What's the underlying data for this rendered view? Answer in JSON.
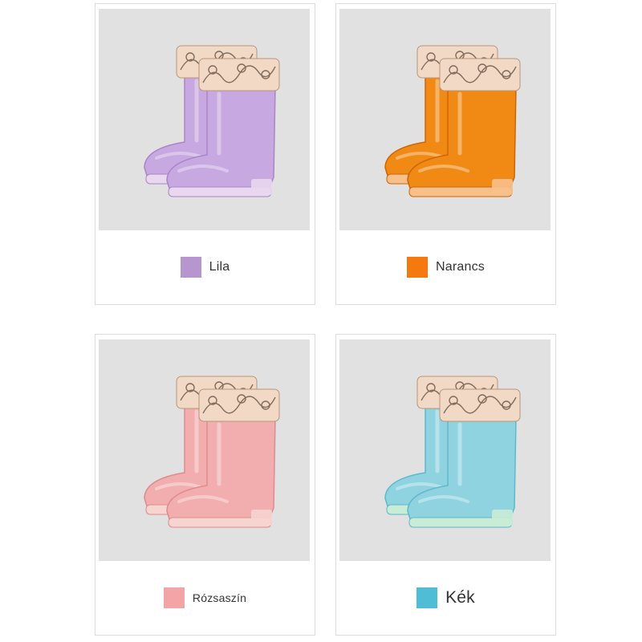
{
  "products": [
    {
      "name": "Lila",
      "swatch": "#b795cf",
      "boot": "#c8a8e0",
      "boot_shade": "#a985c6",
      "sole": "#e8d7ee"
    },
    {
      "name": "Narancs",
      "swatch": "#f47a0f",
      "boot": "#f08a14",
      "boot_shade": "#cc6508",
      "sole": "#f7c08b"
    },
    {
      "name": "Rózsaszín",
      "swatch": "#f4a3a6",
      "boot": "#f2aeae",
      "boot_shade": "#dd8b8e",
      "sole": "#f6d4cf"
    },
    {
      "name": "Kék",
      "swatch": "#4fbdd6",
      "boot": "#8fd3e1",
      "boot_shade": "#5fb8cb",
      "sole": "#c9ecd6"
    }
  ],
  "icons": {
    "boot_image": "rain-boots-pair-image"
  }
}
